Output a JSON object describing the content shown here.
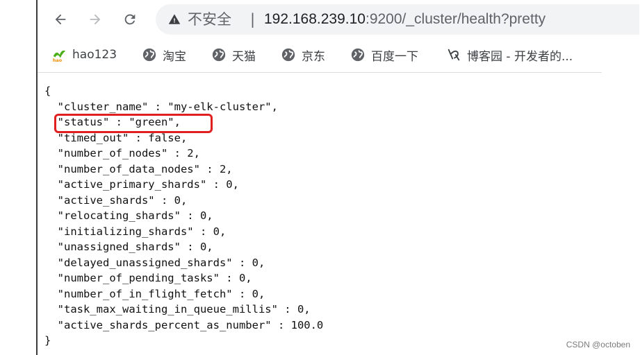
{
  "toolbar": {
    "back_icon": "arrow-left-icon",
    "forward_icon": "arrow-right-icon",
    "reload_icon": "reload-icon",
    "security_icon": "warning-triangle-icon",
    "security_label": "不安全",
    "separator": "|",
    "url_host": "192.168.239.10",
    "url_path": ":9200/_cluster/health?pretty"
  },
  "bookmarks": [
    {
      "label": "hao123",
      "icon": "hao123-icon"
    },
    {
      "label": "淘宝",
      "icon": "globe-icon"
    },
    {
      "label": "天猫",
      "icon": "globe-icon"
    },
    {
      "label": "京东",
      "icon": "globe-icon"
    },
    {
      "label": "百度一下",
      "icon": "globe-icon"
    },
    {
      "label": "博客园 - 开发者的...",
      "icon": "cnblogs-icon"
    }
  ],
  "json_lines": [
    "{",
    "  \"cluster_name\" : \"my-elk-cluster\",",
    "  \"status\" : \"green\",",
    "  \"timed_out\" : false,",
    "  \"number_of_nodes\" : 2,",
    "  \"number_of_data_nodes\" : 2,",
    "  \"active_primary_shards\" : 0,",
    "  \"active_shards\" : 0,",
    "  \"relocating_shards\" : 0,",
    "  \"initializing_shards\" : 0,",
    "  \"unassigned_shards\" : 0,",
    "  \"delayed_unassigned_shards\" : 0,",
    "  \"number_of_pending_tasks\" : 0,",
    "  \"number_of_in_flight_fetch\" : 0,",
    "  \"task_max_waiting_in_queue_millis\" : 0,",
    "  \"active_shards_percent_as_number\" : 100.0",
    "}"
  ],
  "annotation": {
    "color": "#e02020"
  },
  "watermark": "CSDN @octoben",
  "colors": {
    "globe": "#5f6368",
    "hao123_green": "#4caf1a",
    "hao123_orange": "#f28b00"
  }
}
